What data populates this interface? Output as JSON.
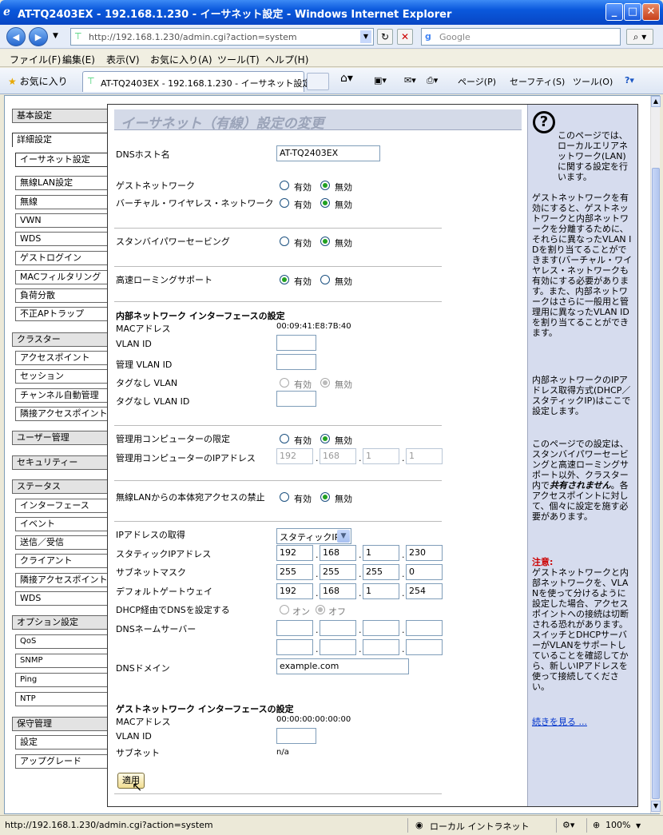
{
  "window": {
    "title": "AT-TQ2403EX - 192.168.1.230 - イーサネット設定 - Windows Internet Explorer"
  },
  "address_bar": {
    "url": "http://192.168.1.230/admin.cgi?action=system",
    "search_placeholder": "Google"
  },
  "menu": [
    "ファイル(F)",
    "編集(E)",
    "表示(V)",
    "お気に入り(A)",
    "ツール(T)",
    "ヘルプ(H)"
  ],
  "tabbar": {
    "favorites": "お気に入り",
    "tab_title": "AT-TQ2403EX - 192.168.1.230 - イーサネット設定",
    "page_menu": "ページ(P)",
    "safety_menu": "セーフティ(S)",
    "tools_menu": "ツール(O)"
  },
  "sidebar": [
    {
      "label": "基本設定",
      "head": true
    },
    {
      "label": "詳細設定",
      "head": true,
      "selected": true
    },
    {
      "label": "イーサネット設定",
      "selected": true
    },
    {
      "label": "無線LAN設定"
    },
    {
      "label": "無線"
    },
    {
      "label": "VWN"
    },
    {
      "label": "WDS"
    },
    {
      "label": "ゲストログイン"
    },
    {
      "label": "MACフィルタリング"
    },
    {
      "label": "負荷分散"
    },
    {
      "label": "不正APトラップ"
    },
    {
      "label": "クラスター",
      "head": true
    },
    {
      "label": "アクセスポイント"
    },
    {
      "label": "セッション"
    },
    {
      "label": "チャンネル自動管理"
    },
    {
      "label": "隣接アクセスポイント"
    },
    {
      "label": "ユーザー管理",
      "head": true
    },
    {
      "label": "セキュリティー",
      "head": true
    },
    {
      "label": "ステータス",
      "head": true
    },
    {
      "label": "インターフェース"
    },
    {
      "label": "イベント"
    },
    {
      "label": "送信／受信"
    },
    {
      "label": "クライアント"
    },
    {
      "label": "隣接アクセスポイント"
    },
    {
      "label": "WDS"
    },
    {
      "label": "オプション設定",
      "head": true
    },
    {
      "label": "QoS"
    },
    {
      "label": "SNMP"
    },
    {
      "label": "Ping"
    },
    {
      "label": "NTP"
    },
    {
      "label": "保守管理",
      "head": true
    },
    {
      "label": "設定"
    },
    {
      "label": "アップグレード"
    }
  ],
  "form": {
    "heading": "イーサネット（有線）設定の変更",
    "dns_host_label": "DNSホスト名",
    "dns_host_value": "AT-TQ2403EX",
    "guest_network_label": "ゲストネットワーク",
    "virtual_wireless_label": "バーチャル・ワイヤレス・ネットワーク",
    "standby_label": "スタンバイパワーセービング",
    "fast_roaming_label": "高速ローミングサポート",
    "enabled": "有効",
    "disabled": "無効",
    "internal_section": "内部ネットワーク インターフェースの設定",
    "mac_label": "MACアドレス",
    "mac_value": "00:09:41:E8:7B:40",
    "vlan_id_label": "VLAN ID",
    "mgmt_vlan_label": "管理 VLAN ID",
    "untagged_vlan_label": "タグなし VLAN",
    "untagged_vlan_id_label": "タグなし VLAN ID",
    "mgmt_pc_limit_label": "管理用コンピューターの限定",
    "mgmt_pc_ip_label": "管理用コンピューターのIPアドレス",
    "mgmt_pc_ip": [
      "192",
      "168",
      "1",
      "1"
    ],
    "wlan_access_label": "無線LANからの本体宛アクセスの禁止",
    "ip_acquire_label": "IPアドレスの取得",
    "ip_acquire_value": "スタティックIP",
    "static_ip_label": "スタティックIPアドレス",
    "static_ip": [
      "192",
      "168",
      "1",
      "230"
    ],
    "subnet_label": "サブネットマスク",
    "subnet": [
      "255",
      "255",
      "255",
      "0"
    ],
    "gateway_label": "デフォルトゲートウェイ",
    "gateway": [
      "192",
      "168",
      "1",
      "254"
    ],
    "dhcp_dns_label": "DHCP経由でDNSを設定する",
    "on": "オン",
    "off": "オフ",
    "dns_server_label": "DNSネームサーバー",
    "dns_domain_label": "DNSドメイン",
    "dns_domain_value": "example.com",
    "guest_section": "ゲストネットワーク インターフェースの設定",
    "guest_mac_value": "00:00:00:00:00:00",
    "guest_subnet_label": "サブネット",
    "guest_subnet_value": "n/a",
    "apply_button": "適用"
  },
  "help": {
    "p1": "このページでは、ローカルエリアネットワーク(LAN)に関する設定を行います。",
    "p2": "ゲストネットワークを有効にすると、ゲストネットワークと内部ネットワークを分離するために、それらに異なったVLAN IDを割り当てることができます(バーチャル・ワイヤレス・ネットワークも有効にする必要があります。また、内部ネットワークはさらに一般用と管理用に異なったVLAN IDを割り当てることができます。",
    "p3": "内部ネットワークのIPアドレス取得方式(DHCP／スタティックIP)はここで設定します。",
    "p4a": "このページでの設定は、スタンバイパワーセービングと高速ローミングサポート以外、クラスター内で",
    "p4b": "共有されません",
    "p4c": "。各アクセスポイントに対して、個々に設定を施す必要があります。",
    "warn_title": "注意:",
    "warn": "ゲストネットワークと内部ネットワークを、VLANを使って分けるように設定した場合、アクセスポイントへの接続は切断される恐れがあります。スイッチとDHCPサーバーがVLANをサポートしていることを確認してから、新しいIPアドレスを使って接続してください。",
    "more_link": "続きを見る ..."
  },
  "statusbar": {
    "url": "http://192.168.1.230/admin.cgi?action=system",
    "zone": "ローカル イントラネット",
    "zoom": "100%"
  }
}
